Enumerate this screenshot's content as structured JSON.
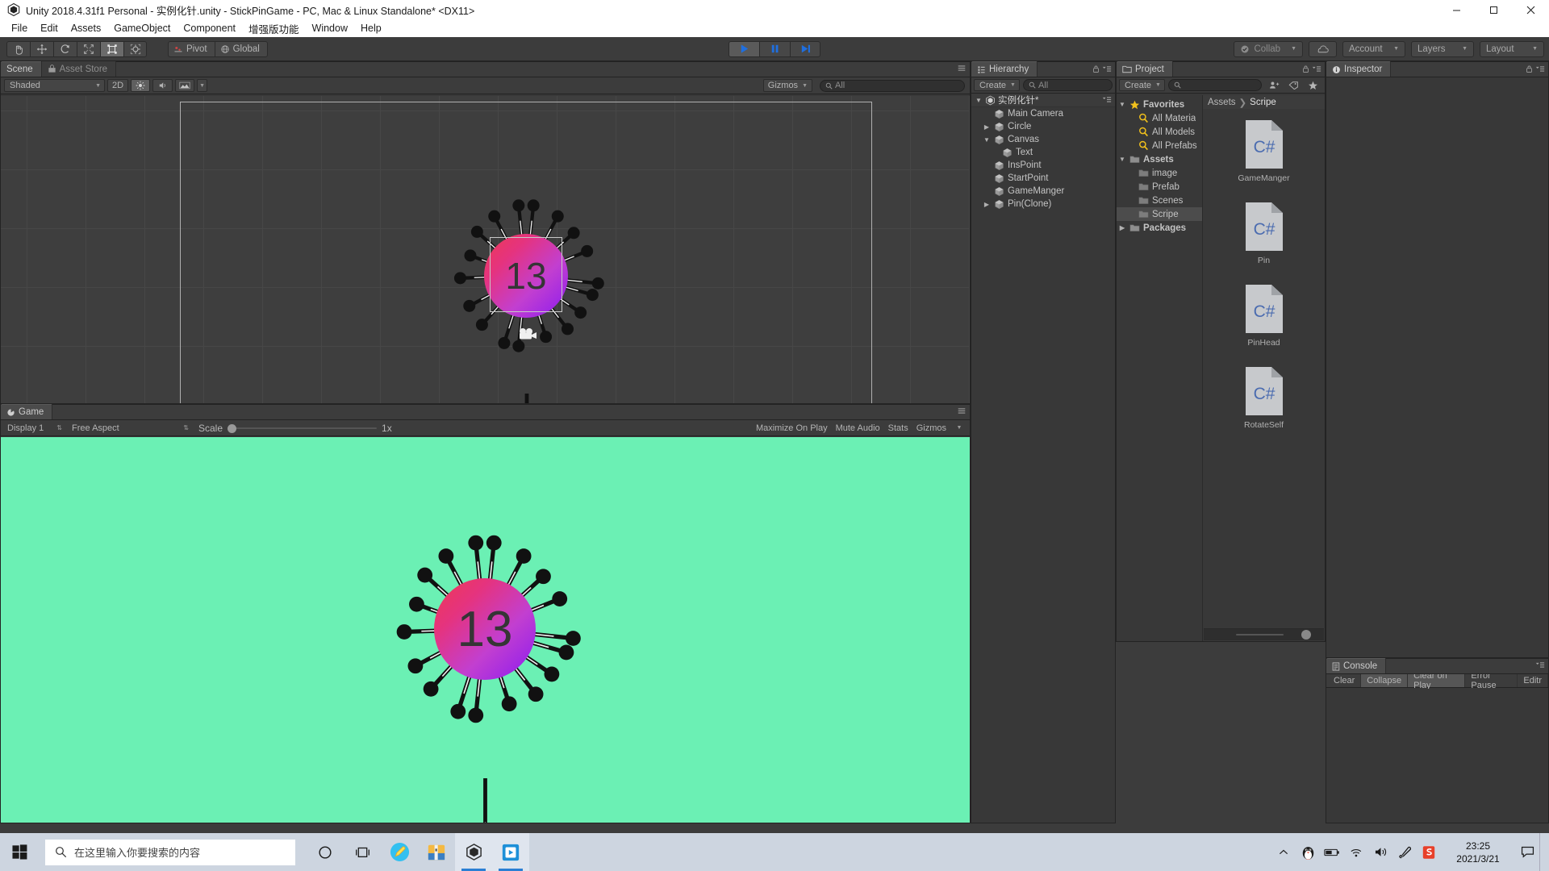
{
  "window": {
    "title": "Unity 2018.4.31f1 Personal - 实例化针.unity - StickPinGame - PC, Mac & Linux Standalone* <DX11>",
    "minimize": "minimize-icon",
    "maximize": "maximize-icon",
    "close": "close-icon"
  },
  "menu": {
    "items": [
      "File",
      "Edit",
      "Assets",
      "GameObject",
      "Component",
      "增强版功能",
      "Window",
      "Help"
    ]
  },
  "toolbar": {
    "tools": [
      "hand-tool",
      "move-tool",
      "rotate-tool",
      "scale-tool",
      "rect-tool",
      "transform-tool"
    ],
    "active_tool_index": 4,
    "pivot": "Pivot",
    "global": "Global",
    "play": "play-button",
    "pause": "pause-button",
    "step": "step-button",
    "collab": "Collab",
    "cloud": "cloud-button",
    "account": "Account",
    "layers": "Layers",
    "layout": "Layout"
  },
  "scene": {
    "tabs": [
      {
        "label": "Scene",
        "icon": "scene-icon",
        "active": true
      },
      {
        "label": "Asset Store",
        "icon": "store-icon",
        "active": false
      }
    ],
    "shading": "Shaded",
    "mode_2d": "2D",
    "lighting": "lighting-icon",
    "audio": "audio-icon",
    "fx": "fx-icon",
    "gizmos": "Gizmos",
    "search_placeholder": "All",
    "search_value": "",
    "score": "13"
  },
  "game": {
    "tab": "Game",
    "display": "Display 1",
    "aspect": "Free Aspect",
    "scale_label": "Scale",
    "scale_value": "1x",
    "maximize": "Maximize On Play",
    "mute": "Mute Audio",
    "stats": "Stats",
    "gizmos": "Gizmos",
    "bg_color": "#6bf0b4",
    "score": "13"
  },
  "hierarchy": {
    "tab": "Hierarchy",
    "create": "Create",
    "search_placeholder": "All",
    "scene_name": "实例化针*",
    "items": [
      {
        "label": "Main Camera",
        "indent": 1,
        "expandable": false,
        "expanded": false
      },
      {
        "label": "Circle",
        "indent": 1,
        "expandable": true,
        "expanded": false
      },
      {
        "label": "Canvas",
        "indent": 1,
        "expandable": true,
        "expanded": true
      },
      {
        "label": "Text",
        "indent": 2,
        "expandable": false,
        "expanded": false
      },
      {
        "label": "InsPoint",
        "indent": 1,
        "expandable": false,
        "expanded": false
      },
      {
        "label": "StartPoint",
        "indent": 1,
        "expandable": false,
        "expanded": false
      },
      {
        "label": "GameManger",
        "indent": 1,
        "expandable": false,
        "expanded": false
      },
      {
        "label": "Pin(Clone)",
        "indent": 1,
        "expandable": true,
        "expanded": false
      }
    ]
  },
  "project": {
    "tab": "Project",
    "create": "Create",
    "search_value": "",
    "breadcrumb": [
      "Assets",
      "Scripe"
    ],
    "tree": [
      {
        "label": "Favorites",
        "type": "favorites",
        "indent": 0,
        "expanded": true,
        "selected": false
      },
      {
        "label": "All Materia",
        "type": "search",
        "indent": 1,
        "expanded": false,
        "selected": false
      },
      {
        "label": "All Models",
        "type": "search",
        "indent": 1,
        "expanded": false,
        "selected": false
      },
      {
        "label": "All Prefabs",
        "type": "search",
        "indent": 1,
        "expanded": false,
        "selected": false
      },
      {
        "label": "Assets",
        "type": "folder",
        "indent": 0,
        "expanded": true,
        "selected": false
      },
      {
        "label": "image",
        "type": "folder",
        "indent": 1,
        "expanded": false,
        "selected": false
      },
      {
        "label": "Prefab",
        "type": "folder",
        "indent": 1,
        "expanded": false,
        "selected": false
      },
      {
        "label": "Scenes",
        "type": "folder",
        "indent": 1,
        "expanded": false,
        "selected": false
      },
      {
        "label": "Scripe",
        "type": "folder",
        "indent": 1,
        "expanded": false,
        "selected": true
      },
      {
        "label": "Packages",
        "type": "folder",
        "indent": 0,
        "expanded": false,
        "selected": false
      }
    ],
    "assets": [
      {
        "name": "GameManger",
        "type": "C#"
      },
      {
        "name": "Pin",
        "type": "C#"
      },
      {
        "name": "PinHead",
        "type": "C#"
      },
      {
        "name": "RotateSelf",
        "type": "C#"
      }
    ]
  },
  "inspector": {
    "tab": "Inspector"
  },
  "console": {
    "tab": "Console",
    "buttons": [
      {
        "label": "Clear",
        "active": false
      },
      {
        "label": "Collapse",
        "active": true
      },
      {
        "label": "Clear on Play",
        "active": true
      },
      {
        "label": "Error Pause",
        "active": false
      },
      {
        "label": "Editr",
        "active": false
      }
    ]
  },
  "taskbar": {
    "start": "windows-start-icon",
    "search_placeholder": "在这里输入你要搜索的内容",
    "icons": [
      "cortana-icon",
      "task-view-icon",
      "paint-3d-icon",
      "winrar-icon",
      "unity-icon",
      "video-editor-icon"
    ],
    "tray": [
      "chevron-up-icon",
      "qq-icon",
      "battery-icon",
      "wifi-icon",
      "volume-icon",
      "pen-icon",
      "sogou-icon"
    ],
    "time": "23:25",
    "date": "2021/3/21",
    "action_center": "notification-icon"
  },
  "colors": {
    "accent_blue": "#2b7fd4",
    "game_bg": "#6bf0b4",
    "circle_start": "#ef3a52",
    "circle_end": "#8b1af0",
    "panel_bg": "#383838"
  },
  "scene_pins": [
    {
      "angle": -96,
      "len": 86
    },
    {
      "angle": -84,
      "len": 86
    },
    {
      "angle": -118,
      "len": 82
    },
    {
      "angle": -138,
      "len": 80
    },
    {
      "angle": -160,
      "len": 72
    },
    {
      "angle": 178,
      "len": 80
    },
    {
      "angle": 152,
      "len": 78
    },
    {
      "angle": 132,
      "len": 80
    },
    {
      "angle": 108,
      "len": 86
    },
    {
      "angle": 96,
      "len": 86
    },
    {
      "angle": 72,
      "len": 78
    },
    {
      "angle": 52,
      "len": 82
    },
    {
      "angle": 34,
      "len": 80
    },
    {
      "angle": 16,
      "len": 84
    },
    {
      "angle": 6,
      "len": 88
    },
    {
      "angle": -22,
      "len": 80
    },
    {
      "angle": -42,
      "len": 78
    },
    {
      "angle": -62,
      "len": 82
    }
  ]
}
